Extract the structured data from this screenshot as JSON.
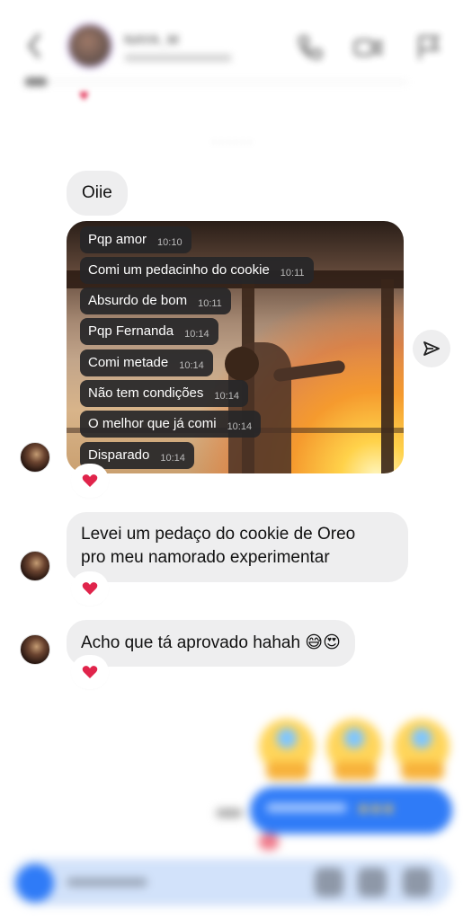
{
  "header": {
    "contact_name": "NAYA_M",
    "back_icon": "chevron-left-icon",
    "icons": [
      "phone-icon",
      "video-icon",
      "flag-icon"
    ]
  },
  "thread": {
    "first_message": "Oiie",
    "photo_captions": [
      {
        "text": "Pqp amor",
        "time": "10:10"
      },
      {
        "text": "Comi um pedacinho do cookie",
        "time": "10:11"
      },
      {
        "text": "Absurdo de bom",
        "time": "10:11"
      },
      {
        "text": "Pqp Fernanda",
        "time": "10:14"
      },
      {
        "text": "Comi metade",
        "time": "10:14"
      },
      {
        "text": "Não tem condições",
        "time": "10:14"
      },
      {
        "text": "O melhor que já comi",
        "time": "10:14"
      },
      {
        "text": "Disparado",
        "time": "10:14"
      }
    ],
    "message_2_line1": "Levei um pedaço do cookie de Oreo",
    "message_2_line2": "pro meu namorado experimentar",
    "message_3": "Acho que tá aprovado hahah 😅😍",
    "reaction": "heart-icon",
    "share_icon": "send-icon"
  },
  "colors": {
    "incoming_bubble": "#eeeeef",
    "outgoing_bubble": "#2f7bf7",
    "reaction_heart": "#e0244b",
    "caption_chip": "#262628"
  }
}
